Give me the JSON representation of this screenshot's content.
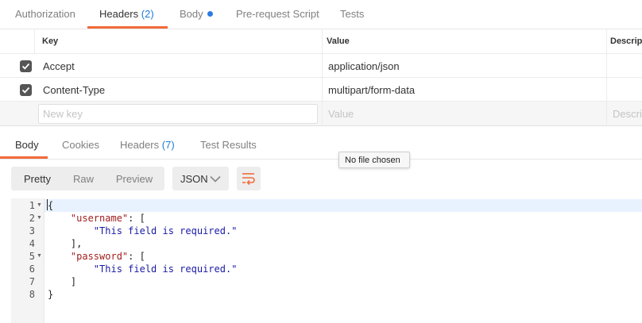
{
  "request_tabs": [
    {
      "label": "Authorization"
    },
    {
      "label": "Headers",
      "count": "(2)"
    },
    {
      "label": "Body"
    },
    {
      "label": "Pre-request Script"
    },
    {
      "label": "Tests"
    }
  ],
  "headers_table": {
    "columns": [
      "Key",
      "Value",
      "Descript"
    ],
    "rows": [
      {
        "checked": true,
        "key": "Accept",
        "value": "application/json"
      },
      {
        "checked": true,
        "key": "Content-Type",
        "value": "multipart/form-data"
      }
    ],
    "new_row": {
      "key_placeholder": "New key",
      "value_placeholder": "Value",
      "description_placeholder": "Descript"
    }
  },
  "response_tabs": [
    {
      "label": "Body"
    },
    {
      "label": "Cookies"
    },
    {
      "label": "Headers",
      "count": "(7)"
    },
    {
      "label": "Test Results"
    }
  ],
  "tooltip": "No file chosen",
  "view_modes": [
    "Pretty",
    "Raw",
    "Preview"
  ],
  "format": "JSON",
  "code": {
    "line_numbers": [
      "1",
      "2",
      "3",
      "4",
      "5",
      "6",
      "7",
      "8"
    ],
    "username_key": "\"username\"",
    "password_key": "\"password\"",
    "error_message": "\"This field is required.\""
  },
  "colors": {
    "accent": "#f26b3a",
    "count": "#1e7bd6",
    "dot": "#2c7be5",
    "json_key": "#a11d1d",
    "json_string": "#1a1aa6"
  }
}
